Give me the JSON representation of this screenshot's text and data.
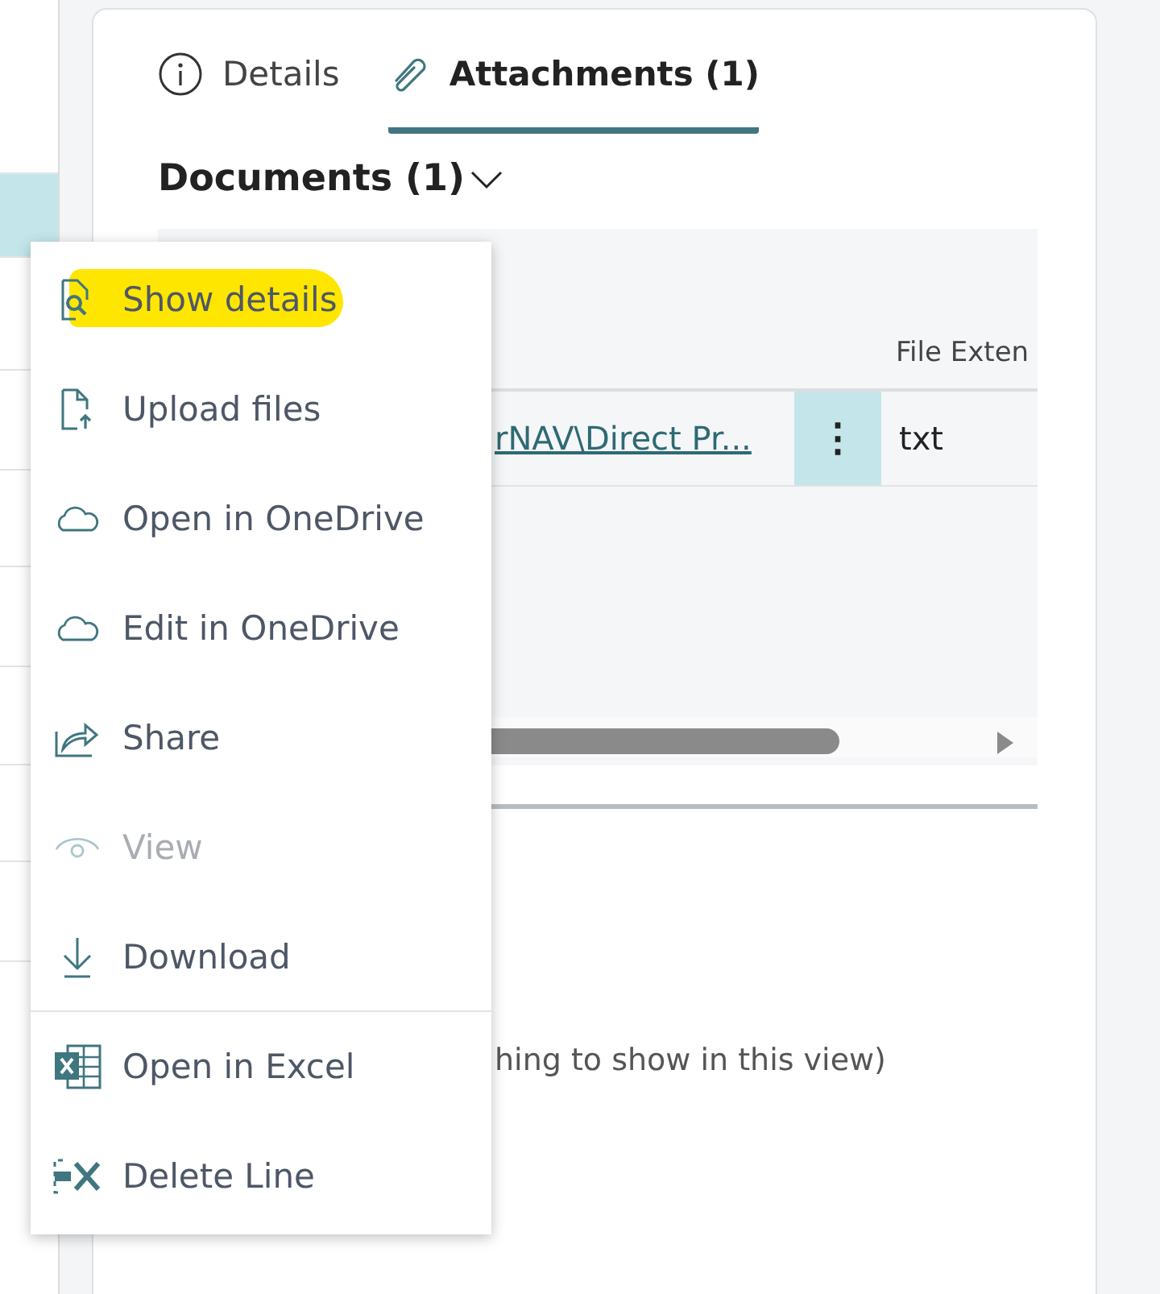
{
  "left_rows": [
    {
      "selected": false
    },
    {
      "selected": true
    },
    {
      "selected": false
    },
    {
      "selected": false
    },
    {
      "selected": false
    },
    {
      "selected": false
    },
    {
      "selected": false
    },
    {
      "selected": false
    },
    {
      "selected": false
    }
  ],
  "tabs": [
    {
      "label": "Details",
      "selected": false
    },
    {
      "label": "Attachments (1)",
      "selected": true
    }
  ],
  "section": {
    "title": "Documents (1)",
    "expanded": true
  },
  "table": {
    "columns": [
      "File Exten"
    ],
    "rows": [
      {
        "link": "rNAV\\Direct Pr...",
        "more": "⋮",
        "extension": "txt",
        "selected": true
      }
    ]
  },
  "empty_text": "hing to show in this view)",
  "menu": {
    "items": [
      {
        "label": "Show details",
        "disabled": false,
        "highlighted": true
      },
      {
        "label": "Upload files",
        "disabled": false,
        "highlighted": false
      },
      {
        "label": "Open in OneDrive",
        "disabled": false,
        "highlighted": false
      },
      {
        "label": "Edit in OneDrive",
        "disabled": false,
        "highlighted": false
      },
      {
        "label": "Share",
        "disabled": false,
        "highlighted": false
      },
      {
        "label": "View",
        "disabled": true,
        "highlighted": false
      },
      {
        "label": "Download",
        "disabled": false,
        "highlighted": false,
        "divider_after": true
      },
      {
        "label": "Open in Excel",
        "disabled": false,
        "highlighted": false
      },
      {
        "label": "Delete Line",
        "disabled": false,
        "highlighted": false
      }
    ]
  }
}
